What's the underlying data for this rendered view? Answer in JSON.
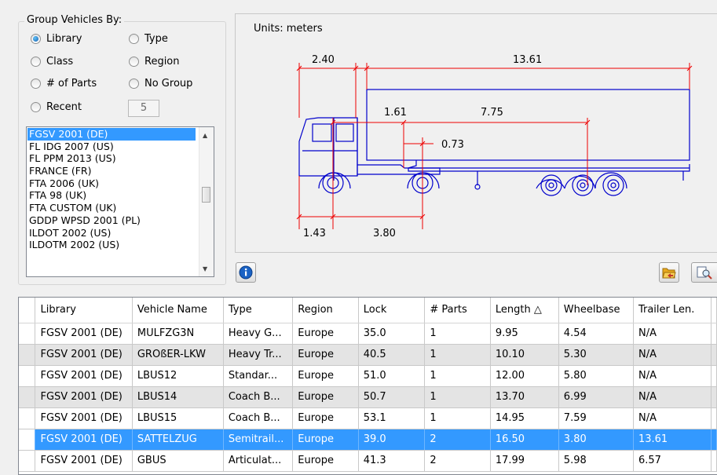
{
  "group_box": {
    "title": "Group Vehicles By:",
    "options": [
      {
        "label": "Library",
        "checked": true
      },
      {
        "label": "Type",
        "checked": false
      },
      {
        "label": "Class",
        "checked": false
      },
      {
        "label": "Region",
        "checked": false
      },
      {
        "label": "# of Parts",
        "checked": false
      },
      {
        "label": "No Group",
        "checked": false
      },
      {
        "label": "Recent",
        "checked": false
      }
    ],
    "recent_count": "5"
  },
  "library_list": {
    "items": [
      "FGSV 2001 (DE)",
      "FL IDG 2007 (US)",
      "FL PPM 2013 (US)",
      "FRANCE (FR)",
      "FTA 2006 (UK)",
      "FTA 98 (UK)",
      "FTA CUSTOM (UK)",
      "GDDP WPSD 2001 (PL)",
      "ILDOT 2002 (US)",
      "ILDOTM 2002 (US)"
    ],
    "selected": "FGSV 2001 (DE)"
  },
  "drawing": {
    "units_label": "Units:  meters",
    "dims": {
      "front_overhang": "2.40",
      "trailer_length": "13.61",
      "d1": "1.61",
      "d2": "7.75",
      "d3": "0.73",
      "d4": "1.43",
      "d5": "3.80"
    },
    "line_color": "#0000cc",
    "dim_color": "#ee0000"
  },
  "table": {
    "columns": [
      "Library",
      "Vehicle Name",
      "Type",
      "Region",
      "Lock",
      "# Parts",
      "Length △",
      "Wheelbase",
      "Trailer Len."
    ],
    "rows": [
      [
        "FGSV 2001 (DE)",
        "MULFZG3N",
        "Heavy G...",
        "Europe",
        "35.0",
        "1",
        "9.95",
        "4.54",
        "N/A"
      ],
      [
        "FGSV 2001 (DE)",
        "GROßER-LKW",
        "Heavy Tr...",
        "Europe",
        "40.5",
        "1",
        "10.10",
        "5.30",
        "N/A"
      ],
      [
        "FGSV 2001 (DE)",
        "LBUS12",
        "Standar...",
        "Europe",
        "51.0",
        "1",
        "12.00",
        "5.80",
        "N/A"
      ],
      [
        "FGSV 2001 (DE)",
        "LBUS14",
        "Coach B...",
        "Europe",
        "50.7",
        "1",
        "13.70",
        "6.99",
        "N/A"
      ],
      [
        "FGSV 2001 (DE)",
        "LBUS15",
        "Coach B...",
        "Europe",
        "53.1",
        "1",
        "14.95",
        "7.59",
        "N/A"
      ],
      [
        "FGSV 2001 (DE)",
        "SATTELZUG",
        "Semitrail...",
        "Europe",
        "39.0",
        "2",
        "16.50",
        "3.80",
        "13.61"
      ],
      [
        "FGSV 2001 (DE)",
        "GBUS",
        "Articulat...",
        "Europe",
        "41.3",
        "2",
        "17.99",
        "5.98",
        "6.57"
      ]
    ],
    "row_styles": [
      "white",
      "gray",
      "white",
      "gray",
      "white",
      "sel",
      "white"
    ]
  },
  "icons": {
    "info": "info-icon",
    "open_folder": "open-folder-icon",
    "preview": "preview-icon"
  }
}
